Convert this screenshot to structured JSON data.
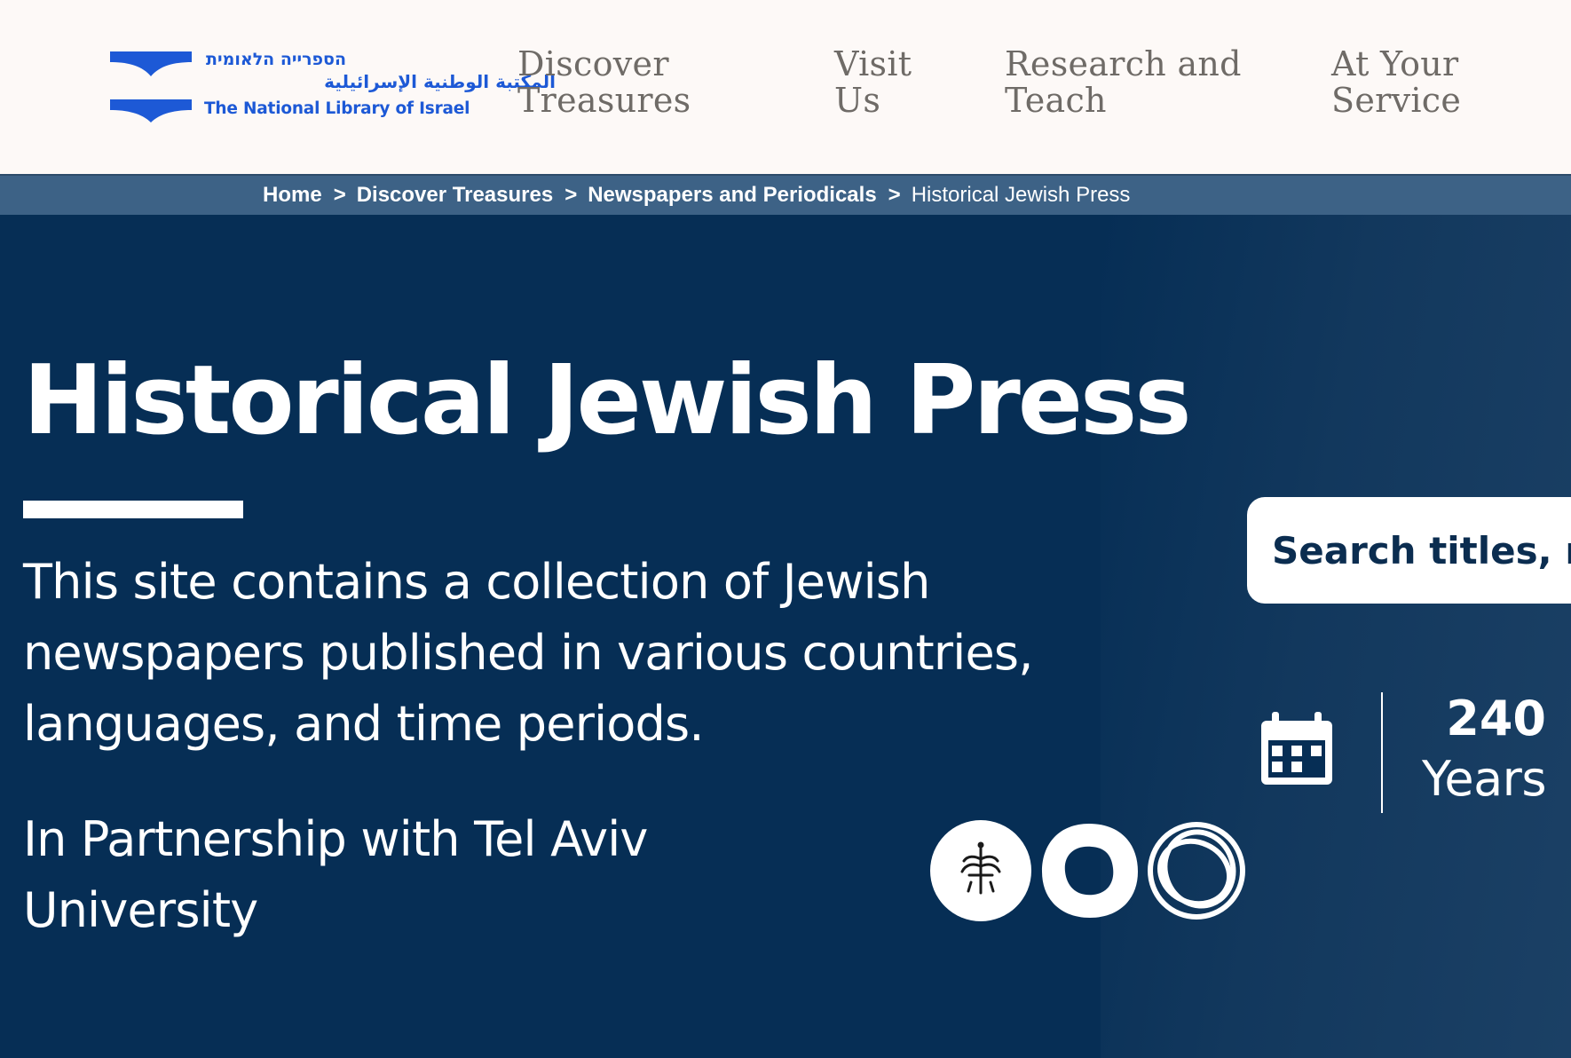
{
  "logo": {
    "hebrew": "הספרייה הלאומית",
    "arabic": "المكتبة الوطنية الإسرائيلية",
    "english": "The National Library of Israel"
  },
  "nav": {
    "items": [
      {
        "line1": "Discover",
        "line2": "Treasures"
      },
      {
        "line1": "Visit",
        "line2": "Us"
      },
      {
        "line1": "Research and",
        "line2": "Teach"
      },
      {
        "line1": "At Your",
        "line2": "Service"
      }
    ]
  },
  "breadcrumb": {
    "items": [
      "Home",
      "Discover Treasures",
      "Newspapers and Periodicals"
    ],
    "current": "Historical Jewish Press",
    "separator": ">"
  },
  "hero": {
    "title": "Historical Jewish Press",
    "description": "This site contains a collection of Jewish newspapers published in various countries, languages, and time periods.",
    "partnership": "In Partnership with Tel Aviv University",
    "partner_logos": [
      "tel-aviv-university-logo",
      "ring-logo",
      "interlocking-rings-logo"
    ]
  },
  "search": {
    "placeholder": "Search titles, names, events"
  },
  "stats": {
    "years_value": "240",
    "years_label": "Years",
    "icon": "calendar-icon"
  },
  "colors": {
    "header_bg": "#fdf9f7",
    "brand_blue": "#1d59d6",
    "nav_text": "#6f6b67",
    "breadcrumb_bg": "#3d6286",
    "hero_bg": "#062e55",
    "search_text": "#0b2d50"
  }
}
